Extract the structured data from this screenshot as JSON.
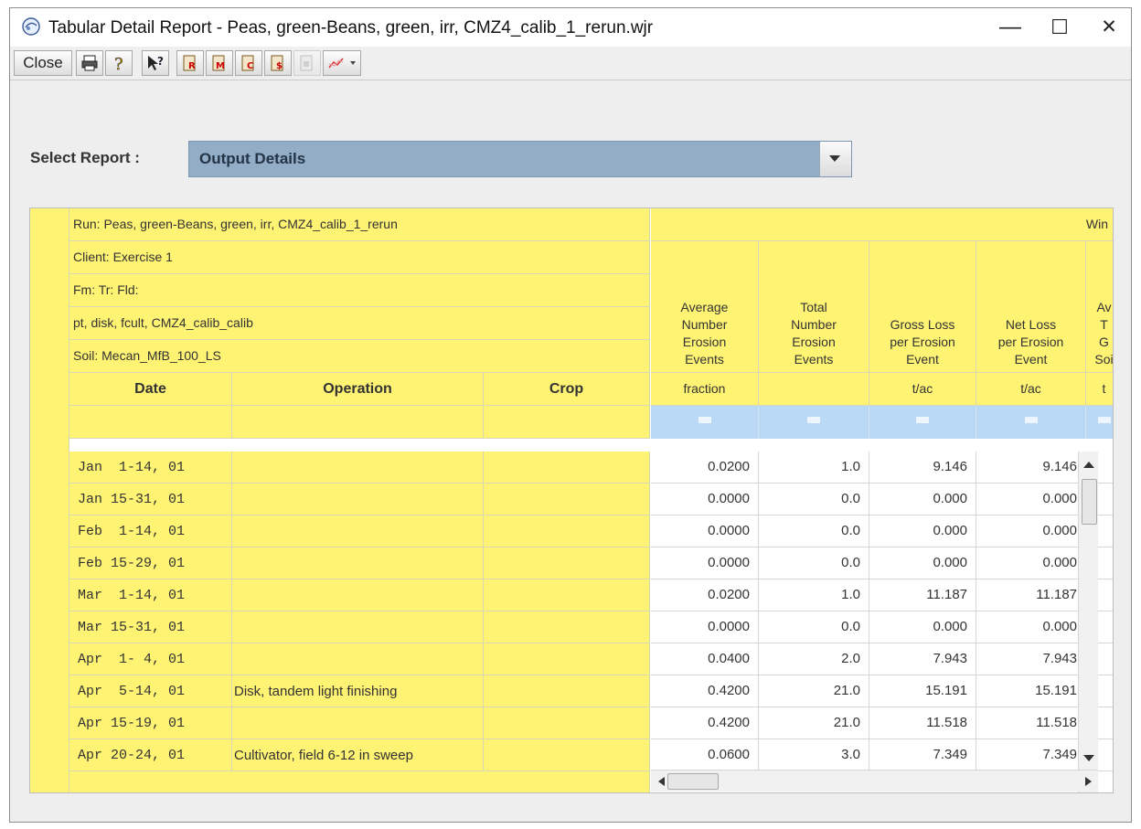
{
  "window": {
    "title": "Tabular Detail Report - Peas, green-Beans, green, irr, CMZ4_calib_1_rerun.wjr",
    "controls": {
      "minimize": "—",
      "maximize": "☐",
      "close": "✕"
    }
  },
  "toolbar": {
    "close_label": "Close",
    "icons": [
      "print-icon",
      "help-icon",
      "context-help-icon",
      "report-r-icon",
      "report-m-icon",
      "report-c-icon",
      "report-dollar-icon",
      "report-disabled-icon",
      "chart-icon"
    ]
  },
  "select_report": {
    "label": "Select Report :",
    "value": "Output Details"
  },
  "grid": {
    "run_info": [
      "Run: Peas, green-Beans, green, irr, CMZ4_calib_1_rerun",
      "Client: Exercise 1",
      "Fm: Tr: Fld:",
      "pt, disk, fcult, CMZ4_calib_calib",
      "Soil: Mecan_MfB_100_LS"
    ],
    "group_header": "Win",
    "left_headers": [
      "Date",
      "Operation",
      "Crop"
    ],
    "data_columns": [
      {
        "title": [
          "Average",
          "Number",
          "Erosion",
          "Events"
        ],
        "unit": "fraction"
      },
      {
        "title": [
          "Total",
          "Number",
          "Erosion",
          "Events"
        ],
        "unit": ""
      },
      {
        "title": [
          "",
          "Gross Loss",
          "per Erosion",
          "Event"
        ],
        "unit": "t/ac"
      },
      {
        "title": [
          "",
          "Net Loss",
          "per Erosion",
          "Event"
        ],
        "unit": "t/ac"
      },
      {
        "title": [
          "Av",
          "T",
          "G",
          "Soi"
        ],
        "unit": "t"
      }
    ],
    "rows": [
      {
        "date": "Jan  1-14, 01",
        "operation": "",
        "crop": "",
        "values": [
          "0.0200",
          "1.0",
          "9.146",
          "9.146"
        ]
      },
      {
        "date": "Jan 15-31, 01",
        "operation": "",
        "crop": "",
        "values": [
          "0.0000",
          "0.0",
          "0.000",
          "0.000"
        ]
      },
      {
        "date": "Feb  1-14, 01",
        "operation": "",
        "crop": "",
        "values": [
          "0.0000",
          "0.0",
          "0.000",
          "0.000"
        ]
      },
      {
        "date": "Feb 15-29, 01",
        "operation": "",
        "crop": "",
        "values": [
          "0.0000",
          "0.0",
          "0.000",
          "0.000"
        ]
      },
      {
        "date": "Mar  1-14, 01",
        "operation": "",
        "crop": "",
        "values": [
          "0.0200",
          "1.0",
          "11.187",
          "11.187"
        ]
      },
      {
        "date": "Mar 15-31, 01",
        "operation": "",
        "crop": "",
        "values": [
          "0.0000",
          "0.0",
          "0.000",
          "0.000"
        ]
      },
      {
        "date": "Apr  1- 4, 01",
        "operation": "",
        "crop": "",
        "values": [
          "0.0400",
          "2.0",
          "7.943",
          "7.943"
        ]
      },
      {
        "date": "Apr  5-14, 01",
        "operation": "Disk, tandem light finishing",
        "crop": "",
        "values": [
          "0.4200",
          "21.0",
          "15.191",
          "15.191"
        ]
      },
      {
        "date": "Apr 15-19, 01",
        "operation": "",
        "crop": "",
        "values": [
          "0.4200",
          "21.0",
          "11.518",
          "11.518"
        ]
      },
      {
        "date": "Apr 20-24, 01",
        "operation": "Cultivator, field 6-12 in sweep",
        "crop": "",
        "values": [
          "0.0600",
          "3.0",
          "7.349",
          "7.349"
        ]
      }
    ]
  }
}
